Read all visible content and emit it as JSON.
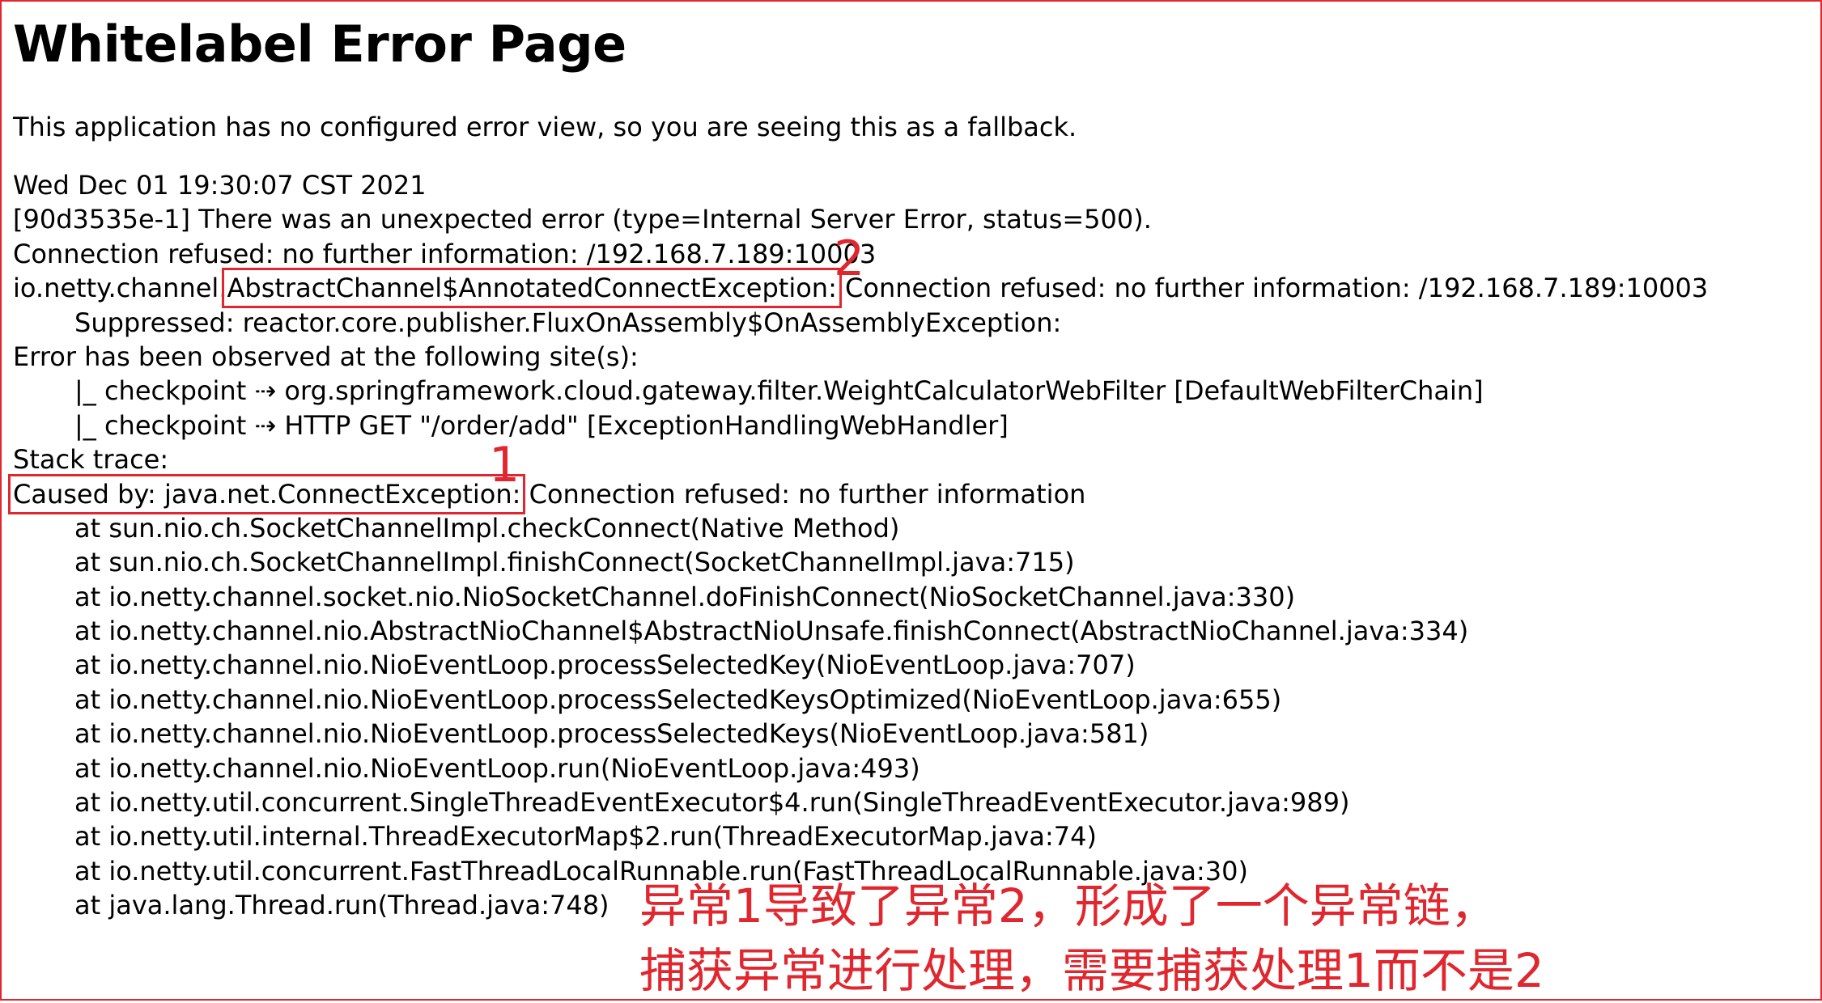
{
  "page": {
    "title": "Whitelabel Error Page",
    "intro": "This application has no configured error view, so you are seeing this as a fallback."
  },
  "error": {
    "timestamp": "Wed Dec 01 19:30:07 CST 2021",
    "summary": "[90d3535e-1] There was an unexpected error (type=Internal Server Error, status=500).",
    "message": "Connection refused: no further information: /192.168.7.189:10003",
    "exception_prefix": "io.netty.channel.",
    "exception_class": "AbstractChannel$AnnotatedConnectException:",
    "exception_message": " Connection refused: no further information: /192.168.7.189:10003",
    "suppressed": "Suppressed: reactor.core.publisher.FluxOnAssembly$OnAssemblyException:",
    "observed_heading": "Error has been observed at the following site(s):",
    "checkpoints": [
      "|_ checkpoint ⇢ org.springframework.cloud.gateway.filter.WeightCalculatorWebFilter [DefaultWebFilterChain]",
      "|_ checkpoint ⇢ HTTP GET \"/order/add\" [ExceptionHandlingWebHandler]"
    ],
    "stack_trace_heading": "Stack trace:",
    "caused_by_class": "Caused by: java.net.ConnectException:",
    "caused_by_message": " Connection refused: no further information",
    "frames": [
      "at sun.nio.ch.SocketChannelImpl.checkConnect(Native Method)",
      "at sun.nio.ch.SocketChannelImpl.finishConnect(SocketChannelImpl.java:715)",
      "at io.netty.channel.socket.nio.NioSocketChannel.doFinishConnect(NioSocketChannel.java:330)",
      "at io.netty.channel.nio.AbstractNioChannel$AbstractNioUnsafe.finishConnect(AbstractNioChannel.java:334)",
      "at io.netty.channel.nio.NioEventLoop.processSelectedKey(NioEventLoop.java:707)",
      "at io.netty.channel.nio.NioEventLoop.processSelectedKeysOptimized(NioEventLoop.java:655)",
      "at io.netty.channel.nio.NioEventLoop.processSelectedKeys(NioEventLoop.java:581)",
      "at io.netty.channel.nio.NioEventLoop.run(NioEventLoop.java:493)",
      "at io.netty.util.concurrent.SingleThreadEventExecutor$4.run(SingleThreadEventExecutor.java:989)",
      "at io.netty.util.internal.ThreadExecutorMap$2.run(ThreadExecutorMap.java:74)",
      "at io.netty.util.concurrent.FastThreadLocalRunnable.run(FastThreadLocalRunnable.java:30)",
      "at java.lang.Thread.run(Thread.java:748)"
    ]
  },
  "annotations": {
    "marker_2": "2",
    "marker_1": "1",
    "note_line_1": "异常1导致了异常2，形成了一个异常链，",
    "note_line_2": "捕获异常进行处理，需要捕获处理1而不是2",
    "color": "#e0262e"
  }
}
